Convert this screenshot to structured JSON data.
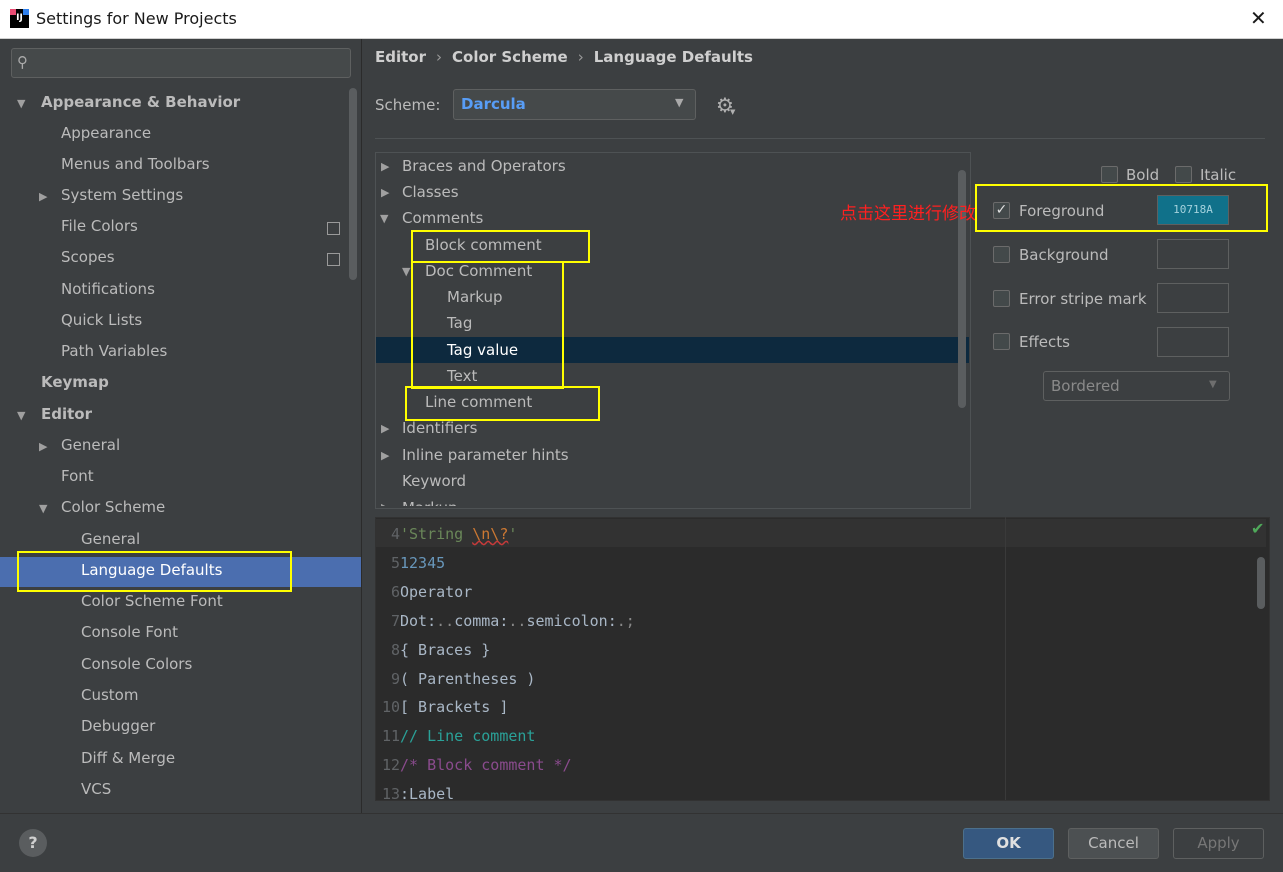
{
  "window": {
    "title": "Settings for New Projects",
    "close_label": "✕",
    "app_icon_text": "IJ"
  },
  "sidebar": {
    "search_placeholder": "",
    "items": [
      {
        "label": "Appearance & Behavior",
        "expanded": true
      },
      {
        "label": "Appearance"
      },
      {
        "label": "Menus and Toolbars"
      },
      {
        "label": "System Settings",
        "expanded": false
      },
      {
        "label": "File Colors"
      },
      {
        "label": "Scopes"
      },
      {
        "label": "Notifications"
      },
      {
        "label": "Quick Lists"
      },
      {
        "label": "Path Variables"
      },
      {
        "label": "Keymap"
      },
      {
        "label": "Editor",
        "expanded": true
      },
      {
        "label": "General",
        "expanded": false
      },
      {
        "label": "Font"
      },
      {
        "label": "Color Scheme",
        "expanded": true
      },
      {
        "label": "General"
      },
      {
        "label": "Language Defaults",
        "selected": true
      },
      {
        "label": "Color Scheme Font"
      },
      {
        "label": "Console Font"
      },
      {
        "label": "Console Colors"
      },
      {
        "label": "Custom"
      },
      {
        "label": "Debugger"
      },
      {
        "label": "Diff & Merge"
      },
      {
        "label": "VCS"
      }
    ]
  },
  "breadcrumb": [
    "Editor",
    "Color Scheme",
    "Language Defaults"
  ],
  "scheme": {
    "label": "Scheme:",
    "value": "Darcula"
  },
  "element_tree": [
    {
      "label": "Braces and Operators",
      "expanded": false
    },
    {
      "label": "Classes",
      "expanded": false
    },
    {
      "label": "Comments",
      "expanded": true
    },
    {
      "label": "Block comment"
    },
    {
      "label": "Doc Comment",
      "expanded": true
    },
    {
      "label": "Markup"
    },
    {
      "label": "Tag"
    },
    {
      "label": "Tag value",
      "selected": true
    },
    {
      "label": "Text"
    },
    {
      "label": "Line comment"
    },
    {
      "label": "Identifiers",
      "expanded": false
    },
    {
      "label": "Inline parameter hints",
      "expanded": false
    },
    {
      "label": "Keyword"
    },
    {
      "label": "Markup",
      "expanded": false
    }
  ],
  "attributes": {
    "bold_label": "Bold",
    "italic_label": "Italic",
    "foreground_label": "Foreground",
    "foreground_checked": true,
    "foreground_value": "10718A",
    "background_label": "Background",
    "error_stripe_label": "Error stripe mark",
    "effects_label": "Effects",
    "effects_type": "Bordered"
  },
  "annotation": "点击这里进行修改",
  "preview": {
    "lines": [
      {
        "num": "4",
        "parts": [
          {
            "t": "'String ",
            "c": "string"
          },
          {
            "t": "\\n\\?",
            "c": "escape"
          },
          {
            "t": "'",
            "c": "string"
          }
        ]
      },
      {
        "num": "5",
        "parts": [
          {
            "t": "12345",
            "c": "number"
          }
        ]
      },
      {
        "num": "6",
        "parts": [
          {
            "t": "Operator",
            "c": "plain"
          }
        ]
      },
      {
        "num": "7",
        "parts": [
          {
            "t": "Dot:",
            "c": "plain"
          },
          {
            "t": "..",
            "c": "dim"
          },
          {
            "t": "comma:",
            "c": "plain"
          },
          {
            "t": "..",
            "c": "dim"
          },
          {
            "t": "semicolon:",
            "c": "plain"
          },
          {
            "t": ".;",
            "c": "dim"
          }
        ]
      },
      {
        "num": "8",
        "parts": [
          {
            "t": "{ Braces }",
            "c": "plain"
          }
        ]
      },
      {
        "num": "9",
        "parts": [
          {
            "t": "( Parentheses )",
            "c": "plain"
          }
        ]
      },
      {
        "num": "10",
        "parts": [
          {
            "t": "[ Brackets ]",
            "c": "plain"
          }
        ]
      },
      {
        "num": "11",
        "parts": [
          {
            "t": "// Line comment",
            "c": "line"
          }
        ]
      },
      {
        "num": "12",
        "parts": [
          {
            "t": "/* Block comment */",
            "c": "block"
          }
        ]
      },
      {
        "num": "13",
        "parts": [
          {
            "t": ":Label",
            "c": "plain"
          }
        ]
      }
    ]
  },
  "buttons": {
    "help": "?",
    "ok": "OK",
    "cancel": "Cancel",
    "apply": "Apply"
  },
  "colors": {
    "selection": "#4b6eaf",
    "foreground_swatch": "#10718a",
    "highlight_box": "#ffff00",
    "annotation_text": "#ff2020"
  }
}
